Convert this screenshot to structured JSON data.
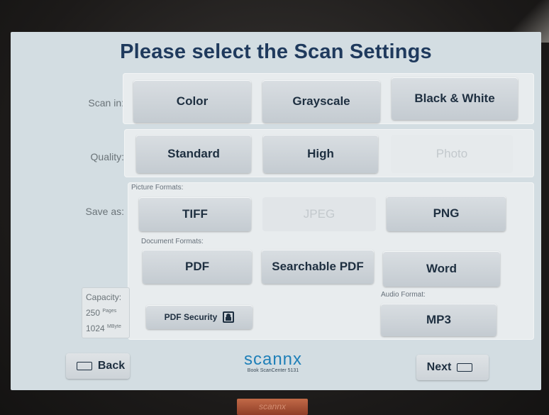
{
  "title": "Please select the Scan Settings",
  "scan_in": {
    "label": "Scan in:",
    "options": [
      "Color",
      "Grayscale",
      "Black & White"
    ]
  },
  "quality": {
    "label": "Quality:",
    "options": [
      "Standard",
      "High",
      "Photo"
    ]
  },
  "save_as": {
    "label": "Save as:",
    "picture_formats_label": "Picture Formats:",
    "picture_formats": [
      "TIFF",
      "JPEG",
      "PNG"
    ],
    "document_formats_label": "Document Formats:",
    "document_formats": [
      "PDF",
      "Searchable PDF",
      "Word"
    ],
    "audio_format_label": "Audio Format:",
    "audio_formats": [
      "MP3"
    ],
    "pdf_security_label": "PDF Security"
  },
  "capacity": {
    "label": "Capacity:",
    "pages_value": "250",
    "pages_unit": "Pages",
    "mbyte_value": "1024",
    "mbyte_unit": "MByte"
  },
  "nav": {
    "back_label": "Back",
    "next_label": "Next"
  },
  "logo": {
    "brand": "scannx",
    "subtitle": "Book ScanCenter 5131"
  },
  "device_badge": "scannx",
  "colors": {
    "title": "#1f3a5d",
    "screen_bg": "#d3dde2",
    "brand": "#1e7fb8"
  }
}
